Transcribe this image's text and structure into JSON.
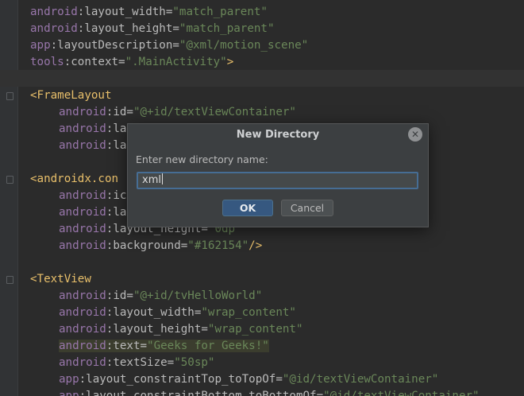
{
  "editor": {
    "lines": [
      {
        "indent": 0,
        "tokens": [
          {
            "t": "android",
            "c": "ns"
          },
          {
            "t": ":layout_width=",
            "c": "attr"
          },
          {
            "t": "\"match_parent\"",
            "c": "val"
          }
        ]
      },
      {
        "indent": 0,
        "tokens": [
          {
            "t": "android",
            "c": "ns"
          },
          {
            "t": ":layout_height=",
            "c": "attr"
          },
          {
            "t": "\"match_parent\"",
            "c": "val"
          }
        ]
      },
      {
        "indent": 0,
        "tokens": [
          {
            "t": "app",
            "c": "ns"
          },
          {
            "t": ":layoutDescription=",
            "c": "attr"
          },
          {
            "t": "\"@xml/motion_scene\"",
            "c": "val"
          }
        ]
      },
      {
        "indent": 0,
        "tokens": [
          {
            "t": "tools",
            "c": "ns"
          },
          {
            "t": ":context=",
            "c": "attr"
          },
          {
            "t": "\".MainActivity\"",
            "c": "val"
          },
          {
            "t": ">",
            "c": "pun"
          }
        ]
      },
      {
        "indent": 0,
        "current": true,
        "tokens": []
      },
      {
        "indent": 0,
        "fold": true,
        "tokens": [
          {
            "t": "<FrameLayout",
            "c": "tag"
          }
        ]
      },
      {
        "indent": 1,
        "tokens": [
          {
            "t": "android",
            "c": "ns"
          },
          {
            "t": ":id=",
            "c": "attr"
          },
          {
            "t": "\"@+id/textViewContainer\"",
            "c": "val"
          }
        ]
      },
      {
        "indent": 1,
        "tokens": [
          {
            "t": "android",
            "c": "ns"
          },
          {
            "t": ":la",
            "c": "attr"
          }
        ]
      },
      {
        "indent": 1,
        "tokens": [
          {
            "t": "android",
            "c": "ns"
          },
          {
            "t": ":la",
            "c": "attr"
          }
        ]
      },
      {
        "indent": 0,
        "tokens": []
      },
      {
        "indent": 0,
        "fold": true,
        "tokens": [
          {
            "t": "<androidx.con",
            "c": "tag"
          }
        ]
      },
      {
        "indent": 1,
        "tokens": [
          {
            "t": "android",
            "c": "ns"
          },
          {
            "t": ":ic",
            "c": "attr"
          }
        ]
      },
      {
        "indent": 1,
        "tokens": [
          {
            "t": "android",
            "c": "ns"
          },
          {
            "t": ":la",
            "c": "attr"
          }
        ]
      },
      {
        "indent": 1,
        "tokens": [
          {
            "t": "android",
            "c": "ns"
          },
          {
            "t": ":layout_height=",
            "c": "attr"
          },
          {
            "t": "\"0dp\"",
            "c": "val"
          }
        ]
      },
      {
        "indent": 1,
        "tokens": [
          {
            "t": "android",
            "c": "ns"
          },
          {
            "t": ":background=",
            "c": "attr"
          },
          {
            "t": "\"#162154\"",
            "c": "val"
          },
          {
            "t": "/>",
            "c": "pun"
          }
        ]
      },
      {
        "indent": 0,
        "tokens": []
      },
      {
        "indent": 0,
        "fold": true,
        "tokens": [
          {
            "t": "<TextView",
            "c": "tag"
          }
        ]
      },
      {
        "indent": 1,
        "tokens": [
          {
            "t": "android",
            "c": "ns"
          },
          {
            "t": ":id=",
            "c": "attr"
          },
          {
            "t": "\"@+id/tvHelloWorld\"",
            "c": "val"
          }
        ]
      },
      {
        "indent": 1,
        "tokens": [
          {
            "t": "android",
            "c": "ns"
          },
          {
            "t": ":layout_width=",
            "c": "attr"
          },
          {
            "t": "\"wrap_content\"",
            "c": "val"
          }
        ]
      },
      {
        "indent": 1,
        "tokens": [
          {
            "t": "android",
            "c": "ns"
          },
          {
            "t": ":layout_height=",
            "c": "attr"
          },
          {
            "t": "\"wrap_content\"",
            "c": "val"
          }
        ]
      },
      {
        "indent": 1,
        "highlight": true,
        "tokens": [
          {
            "t": "android",
            "c": "ns"
          },
          {
            "t": ":text=",
            "c": "attr"
          },
          {
            "t": "\"Geeks for Geeks!\"",
            "c": "val"
          }
        ]
      },
      {
        "indent": 1,
        "tokens": [
          {
            "t": "android",
            "c": "ns"
          },
          {
            "t": ":textSize=",
            "c": "attr"
          },
          {
            "t": "\"50sp\"",
            "c": "val"
          }
        ]
      },
      {
        "indent": 1,
        "tokens": [
          {
            "t": "app",
            "c": "ns"
          },
          {
            "t": ":layout_constraintTop_toTopOf=",
            "c": "attr"
          },
          {
            "t": "\"@id/textViewContainer\"",
            "c": "val"
          }
        ]
      },
      {
        "indent": 1,
        "tokens": [
          {
            "t": "app",
            "c": "ns"
          },
          {
            "t": ":layout_constraintBottom_toBottomOf=",
            "c": "attr"
          },
          {
            "t": "\"@id/textViewContainer\"",
            "c": "val"
          }
        ]
      }
    ]
  },
  "dialog": {
    "title": "New Directory",
    "close_icon": "close-icon",
    "label": "Enter new directory name:",
    "input_value": "xml",
    "ok_label": "OK",
    "cancel_label": "Cancel"
  },
  "colors": {
    "editor_background": "#2b2b2b",
    "namespace": "#9876aa",
    "attribute": "#bababa",
    "value": "#6a8759",
    "tag": "#e8bf6a",
    "dialog_background": "#3c3f41",
    "ok_button": "#365880",
    "input_focus_border": "#466d94"
  }
}
